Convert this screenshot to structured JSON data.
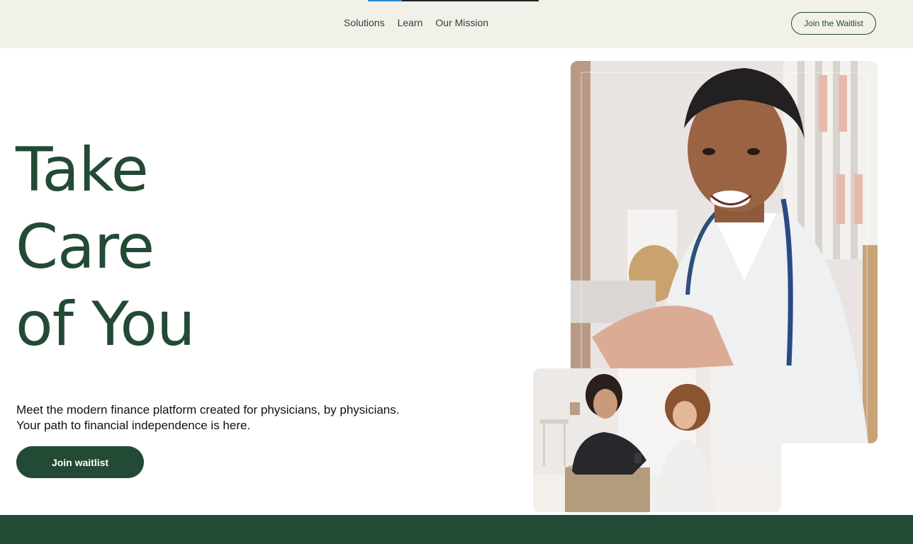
{
  "header": {
    "scroll_progress": 0.2,
    "nav": [
      {
        "label": "Solutions"
      },
      {
        "label": "Learn"
      },
      {
        "label": "Our Mission"
      }
    ],
    "waitlist_button": "Join the Waitlist"
  },
  "hero": {
    "headline": [
      "Take",
      "Care",
      "of You"
    ],
    "subtext": [
      "Meet the modern finance platform created for physicians, by physicians.",
      "Your path to financial independence is here."
    ],
    "cta": "Join waitlist"
  },
  "colors": {
    "brand_green": "#224a35",
    "header_bg": "#f1f1ea",
    "progress_accent": "#2f86d6"
  }
}
